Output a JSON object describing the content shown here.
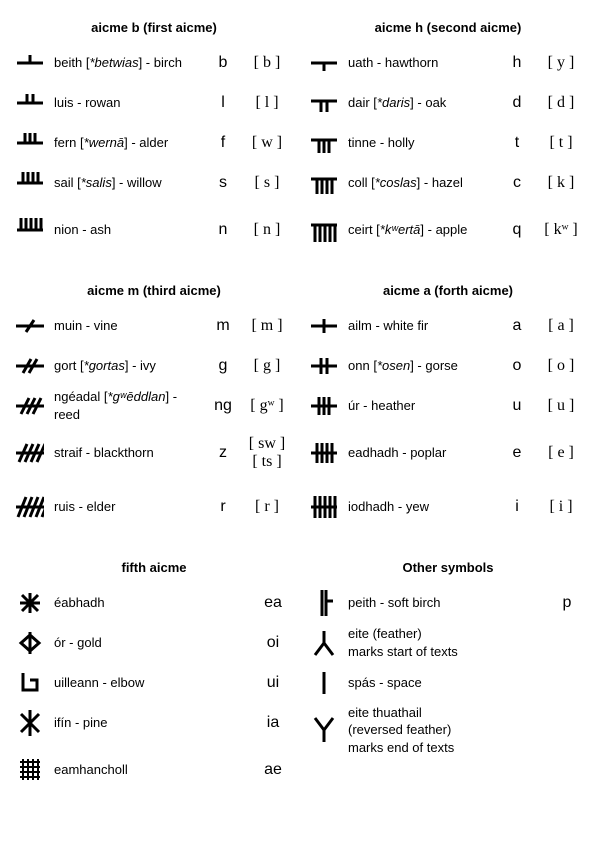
{
  "sections": {
    "b": {
      "title": "aicme b (first aicme)",
      "rows": [
        {
          "name": "beith",
          "etym": "*betwias",
          "tree": "birch",
          "tr": "b",
          "ipa": "[ b ]"
        },
        {
          "name": "luis",
          "etym": "",
          "tree": "rowan",
          "tr": "l",
          "ipa": "[ l ]"
        },
        {
          "name": "fern",
          "etym": "*wernā",
          "tree": "alder",
          "tr": "f",
          "ipa": "[ w ]"
        },
        {
          "name": "sail",
          "etym": "*salis",
          "tree": "willow",
          "tr": "s",
          "ipa": "[ s ]"
        },
        {
          "name": "nion",
          "etym": "",
          "tree": "ash",
          "tr": "n",
          "ipa": "[ n ]"
        }
      ]
    },
    "h": {
      "title": "aicme h (second aicme)",
      "rows": [
        {
          "name": "uath",
          "etym": "",
          "tree": "hawthorn",
          "tr": "h",
          "ipa": "[ y ]"
        },
        {
          "name": "dair",
          "etym": "*daris",
          "tree": "oak",
          "tr": "d",
          "ipa": "[ d ]"
        },
        {
          "name": "tinne",
          "etym": "",
          "tree": "holly",
          "tr": "t",
          "ipa": "[ t ]"
        },
        {
          "name": "coll",
          "etym": "*coslas",
          "tree": "hazel",
          "tr": "c",
          "ipa": "[ k ]"
        },
        {
          "name": "ceirt",
          "etym": "*kʷertā",
          "tree": "apple",
          "tr": "q",
          "ipa": "[ kʷ ]"
        }
      ]
    },
    "m": {
      "title": "aicme m (third aicme)",
      "rows": [
        {
          "name": "muin",
          "etym": "",
          "tree": "vine",
          "tr": "m",
          "ipa": "[ m ]"
        },
        {
          "name": "gort",
          "etym": "*gortas",
          "tree": "ivy",
          "tr": "g",
          "ipa": "[ g ]"
        },
        {
          "name": "ngéadal",
          "etym": "*gʷēddlan",
          "tree": "reed",
          "tr": "ng",
          "ipa": "[ gʷ ]"
        },
        {
          "name": "straif",
          "etym": "",
          "tree": "blackthorn",
          "tr": "z",
          "ipa": "[ sw ]",
          "ipa2": "[ ts ]"
        },
        {
          "name": "ruis",
          "etym": "",
          "tree": "elder",
          "tr": "r",
          "ipa": "[ r ]"
        }
      ]
    },
    "a": {
      "title": "aicme a (forth aicme)",
      "rows": [
        {
          "name": "ailm",
          "etym": "",
          "tree": "white fir",
          "tr": "a",
          "ipa": "[ a ]"
        },
        {
          "name": "onn",
          "etym": "*osen",
          "tree": "gorse",
          "tr": "o",
          "ipa": "[ o ]"
        },
        {
          "name": "úr",
          "etym": "",
          "tree": "heather",
          "tr": "u",
          "ipa": "[ u ]"
        },
        {
          "name": "eadhadh",
          "etym": "",
          "tree": "poplar",
          "tr": "e",
          "ipa": "[ e ]"
        },
        {
          "name": "iodhadh",
          "etym": "",
          "tree": "yew",
          "tr": "i",
          "ipa": "[ i ]"
        }
      ]
    },
    "fifth": {
      "title": "fifth aicme",
      "rows": [
        {
          "name": "éabhadh",
          "etym": "",
          "tree": "",
          "tr": "ea"
        },
        {
          "name": "ór",
          "etym": "",
          "tree": "gold",
          "tr": "oi"
        },
        {
          "name": "uilleann",
          "etym": "",
          "tree": "elbow",
          "tr": "ui"
        },
        {
          "name": "ifín",
          "etym": "",
          "tree": "pine",
          "tr": "ia"
        },
        {
          "name": "eamhancholl",
          "etym": "",
          "tree": "",
          "tr": "ae"
        }
      ]
    },
    "other": {
      "title": "Other symbols",
      "rows": [
        {
          "name": "peith",
          "tree": "soft birch",
          "tr": "p"
        },
        {
          "desc_multi": "eite (feather)\nmarks start of texts"
        },
        {
          "name": "spás",
          "tree": "space"
        },
        {
          "desc_multi": "eite thuathail\n(reversed feather)\nmarks end of texts"
        }
      ]
    }
  }
}
